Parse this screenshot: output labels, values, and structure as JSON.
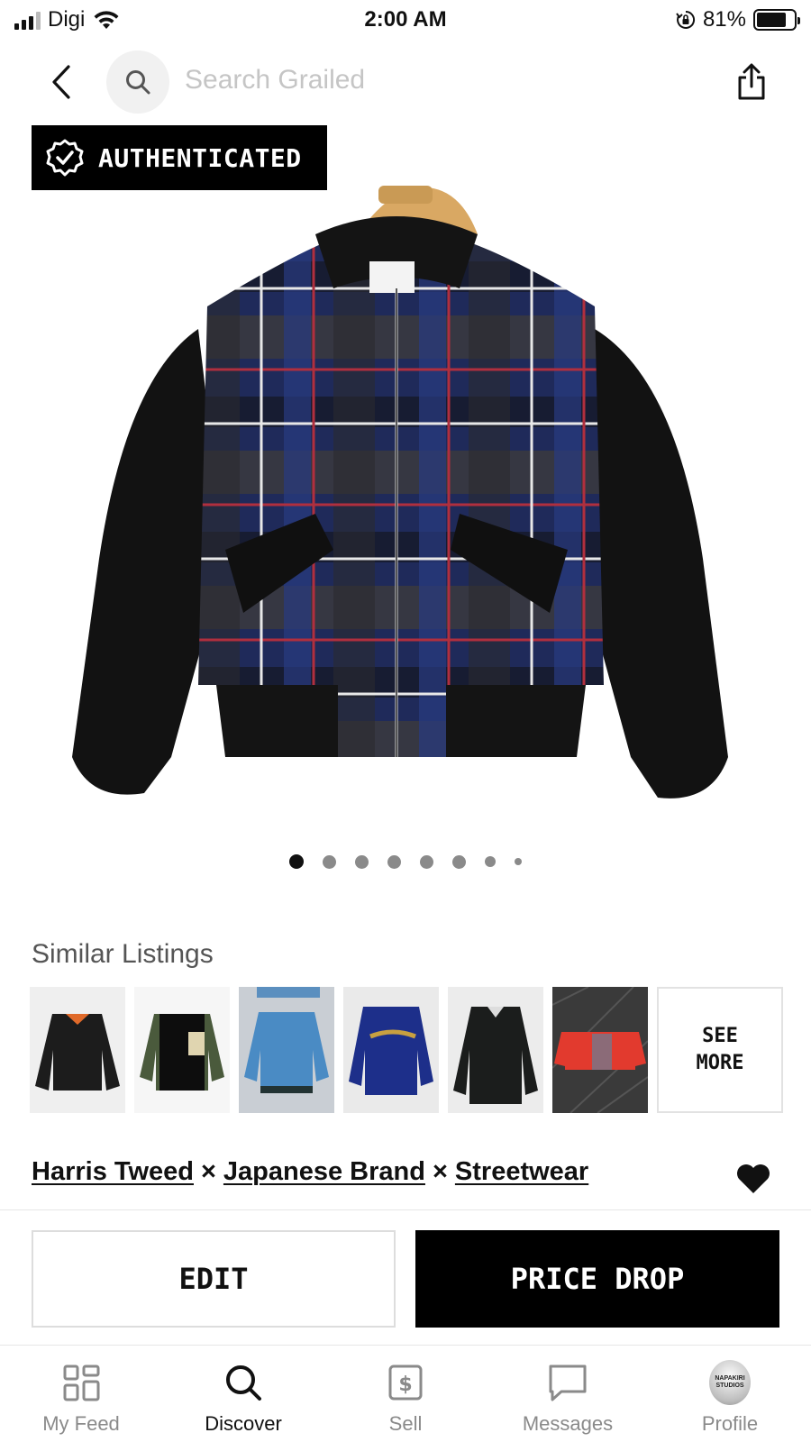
{
  "status_bar": {
    "carrier": "Digi",
    "time": "2:00 AM",
    "battery_percent": "81%",
    "battery_level": 0.81
  },
  "nav": {
    "search_placeholder": "Search Grailed"
  },
  "product": {
    "badge": "AUTHENTICATED",
    "image_count": 8,
    "active_image": 1
  },
  "similar": {
    "title": "Similar Listings",
    "see_more": "SEE\nMORE"
  },
  "brands": [
    "Harris Tweed",
    "Japanese Brand",
    "Streetwear"
  ],
  "brand_separator": "×",
  "actions": {
    "edit": "EDIT",
    "price_drop": "PRICE DROP"
  },
  "tabs": [
    {
      "label": "My Feed",
      "icon": "grid-icon",
      "active": false
    },
    {
      "label": "Discover",
      "icon": "search-icon",
      "active": true
    },
    {
      "label": "Sell",
      "icon": "dollar-tag-icon",
      "active": false
    },
    {
      "label": "Messages",
      "icon": "chat-bubble-icon",
      "active": false
    },
    {
      "label": "Profile",
      "icon": "avatar",
      "active": false
    }
  ],
  "avatar_text": "NAPAKIRI STUDIOS",
  "colors": {
    "primary": "#000000",
    "inactive_tab": "#8a8a8a",
    "placeholder": "#c5c5c5"
  }
}
